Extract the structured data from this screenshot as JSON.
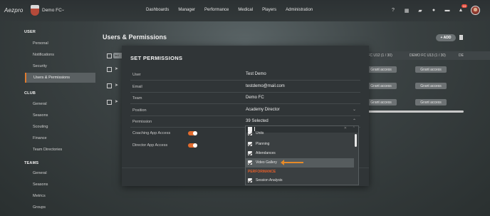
{
  "app": {
    "logo": "Aezpro",
    "club_name": "Demo FC"
  },
  "nav": {
    "links": [
      "Dashboards",
      "Manager",
      "Performance",
      "Medical",
      "Players",
      "Administration"
    ],
    "notification_count": "10"
  },
  "sidebar": {
    "sections": [
      {
        "title": "USER",
        "items": [
          "Personal",
          "Notifications",
          "Security",
          "Users & Permissions"
        ]
      },
      {
        "title": "CLUB",
        "items": [
          "General",
          "Seasons",
          "Scouting",
          "Finance",
          "Team Directories"
        ]
      },
      {
        "title": "TEAMS",
        "items": [
          "General",
          "Seasons",
          "Metrics",
          "Groups"
        ]
      }
    ],
    "active": "Users & Permissions"
  },
  "main": {
    "title": "Users & Permissions",
    "add_label": "+ ADD",
    "table": {
      "headers": [
        "O FC U12 (1 / 30)",
        "DEMO FC U13 (1 / 30)",
        "DE"
      ],
      "header_pill": "Ied",
      "grant_label": "Grant access"
    }
  },
  "modal": {
    "title": "SET PERMISSIONS",
    "rows": [
      {
        "label": "User",
        "value": "Test Demo"
      },
      {
        "label": "Email",
        "value": "testdemo@mail.com"
      },
      {
        "label": "Team",
        "value": "Demo FC"
      },
      {
        "label": "Position",
        "value": "Academy Director"
      },
      {
        "label": "Permission",
        "value": "39 Selected"
      }
    ],
    "toggles": [
      {
        "label": "Coaching App Access",
        "on": true
      },
      {
        "label": "Director App Access",
        "on": true
      }
    ],
    "dropdown": {
      "items": [
        "Units",
        "Planning",
        "Attendances",
        "Video Gallery"
      ],
      "group": "PERFORMANCE",
      "group_items": [
        "Session Analysis"
      ],
      "highlighted": "Video Gallery"
    }
  },
  "colors": {
    "accent": "#e36b2d",
    "arrow": "#e58a28"
  }
}
